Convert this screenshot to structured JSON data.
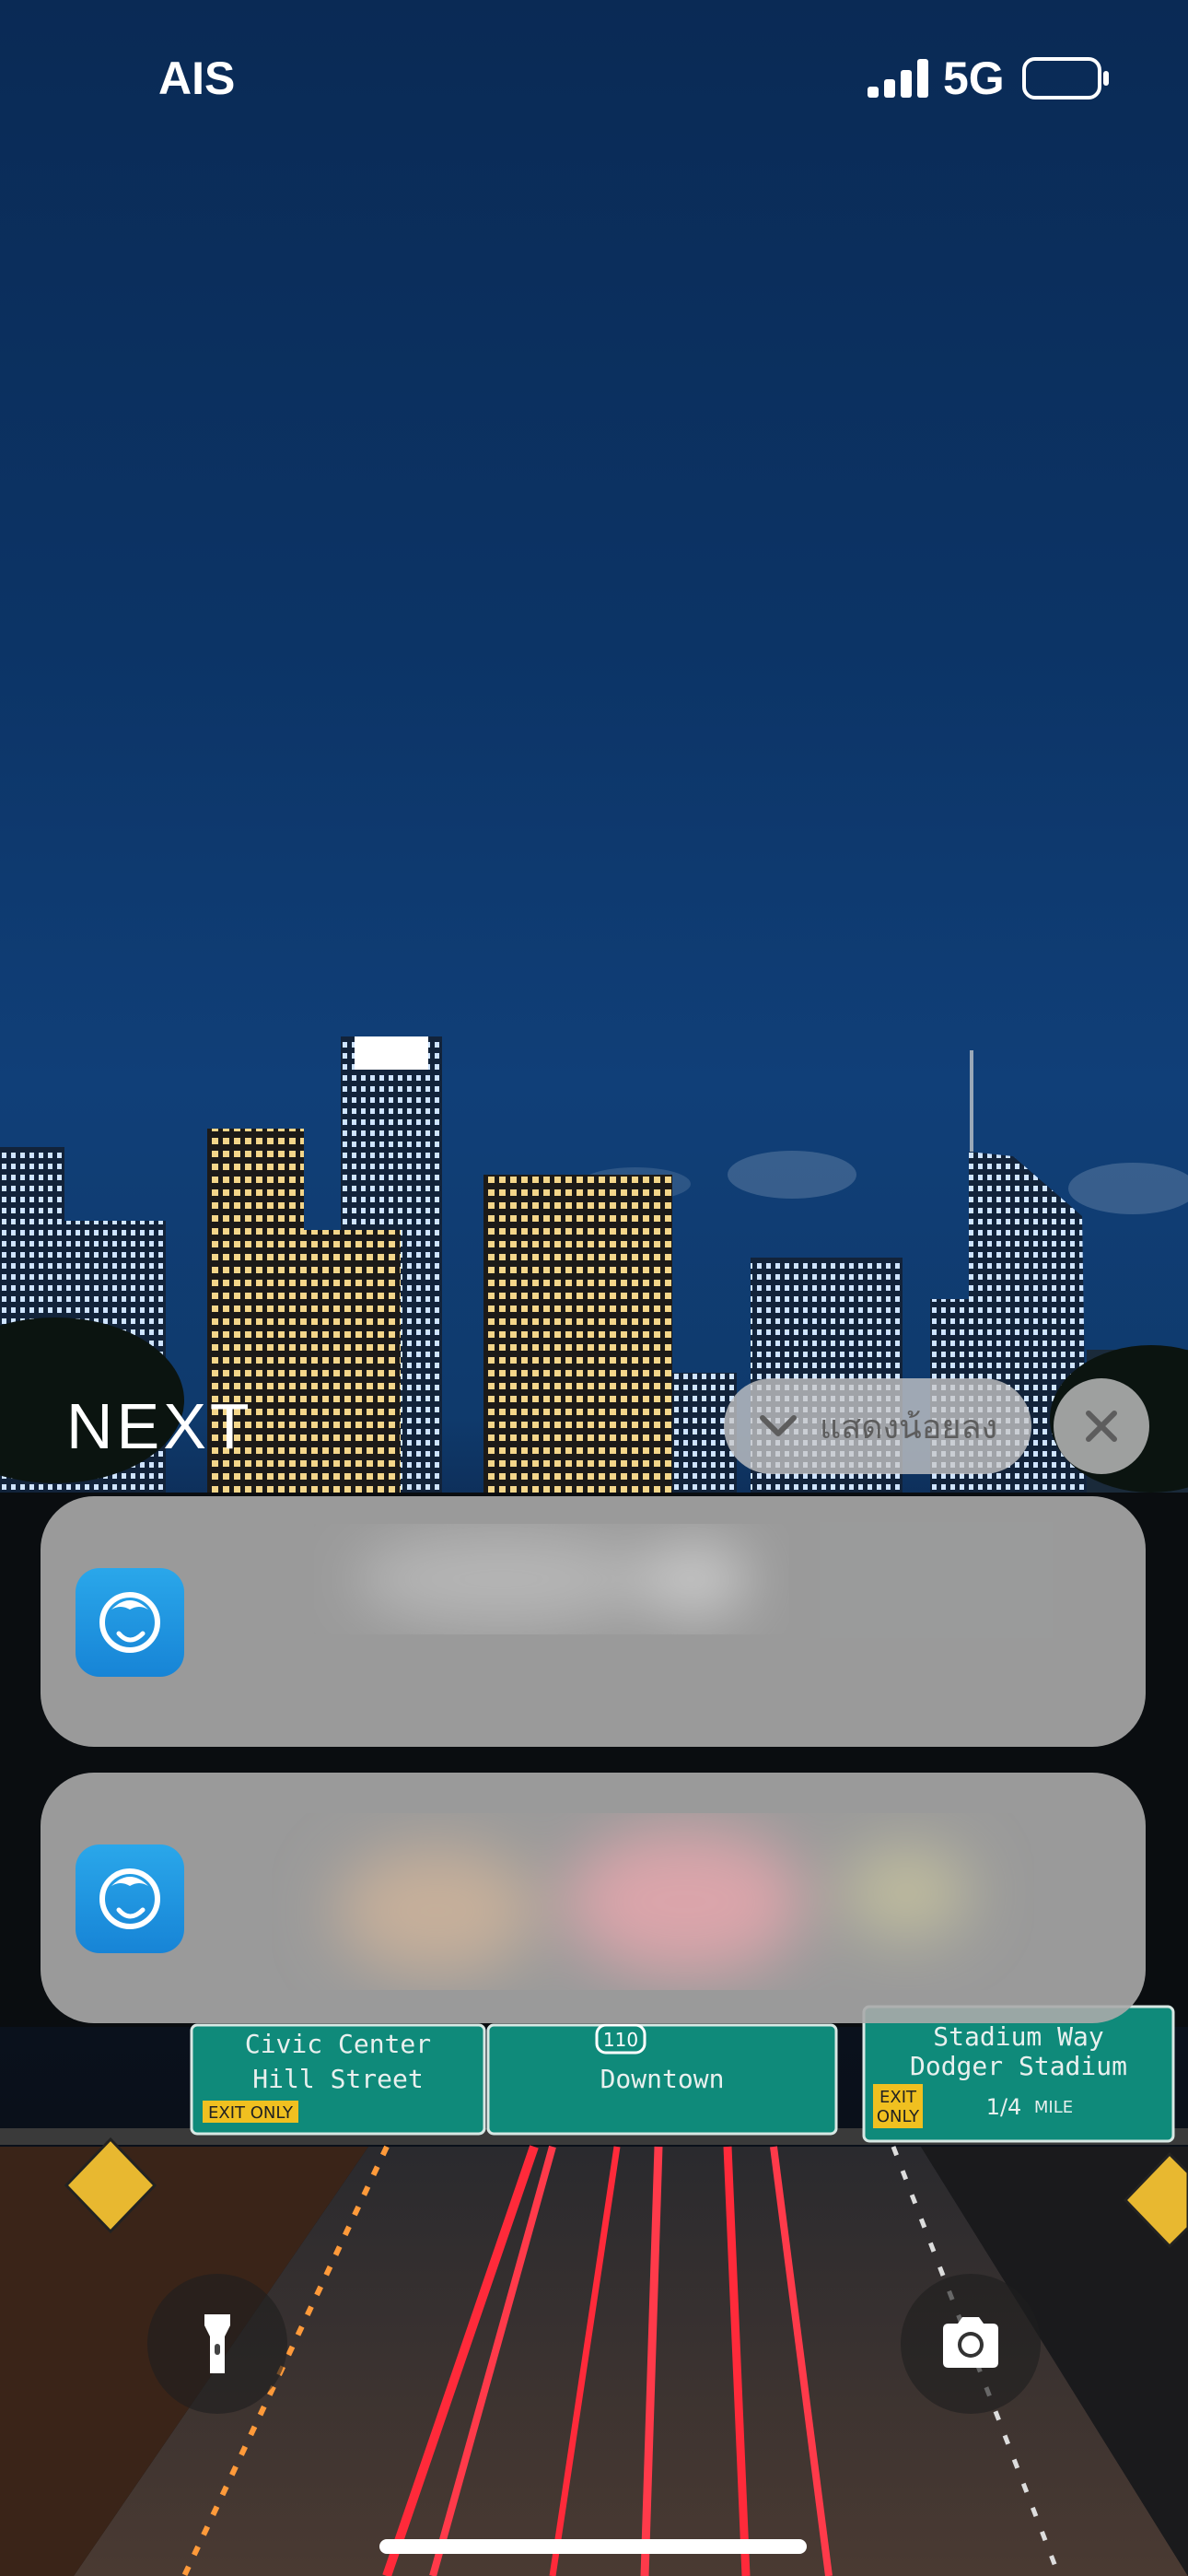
{
  "status_bar": {
    "carrier": "AIS",
    "network": "5G",
    "signal_icon": "cellular-signal-icon",
    "battery_icon": "battery-icon"
  },
  "notification_center": {
    "section_title": "NEXT",
    "show_less_label": "แสดงน้อยลง",
    "show_less_icon": "chevron-down-icon",
    "close_icon": "close-icon",
    "notifications": [
      {
        "app_icon": "app-logo-icon",
        "content": ""
      },
      {
        "app_icon": "app-logo-icon",
        "content": ""
      }
    ]
  },
  "lockscreen_controls": {
    "flashlight_icon": "flashlight-icon",
    "camera_icon": "camera-icon"
  },
  "wallpaper": {
    "signs": {
      "left_line1": "Civic Center",
      "left_line2": "Hill Street",
      "left_exit": "EXIT ONLY",
      "center_route": "110",
      "center_line": "Downtown",
      "right_line1": "Stadium Way",
      "right_line2": "Dodger Stadium",
      "right_exit_line1": "EXIT",
      "right_exit_line2": "ONLY",
      "right_distance": "1/4",
      "right_unit": "MILE"
    }
  },
  "colors": {
    "sky": "#0c3466",
    "notification_bg": "#aaaaaa",
    "app_icon_bg": "#1a8fdc",
    "sign_green": "#0f8a7a"
  }
}
